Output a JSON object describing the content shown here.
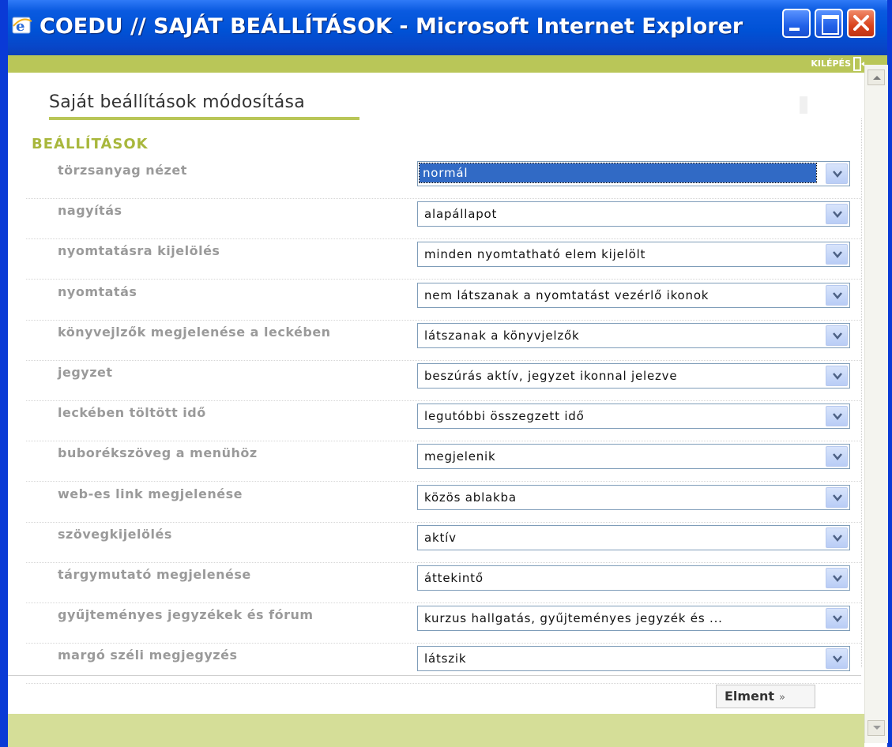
{
  "window": {
    "title": "COEDU // SAJÁT BEÁLLÍTÁSOK - Microsoft Internet Explorer",
    "buttons": [
      "minimize",
      "maximize",
      "close"
    ]
  },
  "header": {
    "exit_label": "KILÉPÉS",
    "exit_icon": "door-exit-icon"
  },
  "page": {
    "title": "Saját beállítások módosítása",
    "section": "BEÁLLÍTÁSOK"
  },
  "settings": [
    {
      "label": "törzsanyag nézet",
      "value": "normál",
      "focused": true
    },
    {
      "label": "nagyítás",
      "value": "alapállapot"
    },
    {
      "label": "nyomtatásra kijelölés",
      "value": "minden nyomtatható elem kijelölt"
    },
    {
      "label": "nyomtatás",
      "value": "nem látszanak a nyomtatást vezérlő ikonok"
    },
    {
      "label": "könyvejlzők megjelenése a leckében",
      "value": "látszanak a könyvjelzők"
    },
    {
      "label": "jegyzet",
      "value": "beszúrás aktív, jegyzet ikonnal jelezve"
    },
    {
      "label": "leckében töltött idő",
      "value": "legutóbbi összegzett idő"
    },
    {
      "label": "buborékszöveg a menühöz",
      "value": "megjelenik"
    },
    {
      "label": "web-es link megjelenése",
      "value": "közös ablakba"
    },
    {
      "label": "szövegkijelölés",
      "value": "aktív"
    },
    {
      "label": "tárgymutató megjelenése",
      "value": "áttekintő"
    },
    {
      "label": "gyűjteményes jegyzékek és fórum",
      "value": "kurzus hallgatás, gyűjteményes jegyzék és ..."
    },
    {
      "label": "margó széli megjegyzés",
      "value": "látszik"
    }
  ],
  "actions": {
    "save_label": "Elment",
    "save_chevron": "»"
  },
  "colors": {
    "accent_green": "#b9c658",
    "section_green": "#a8b73c",
    "titlebar_blue": "#0052d6",
    "selection_blue": "#316ac5"
  }
}
